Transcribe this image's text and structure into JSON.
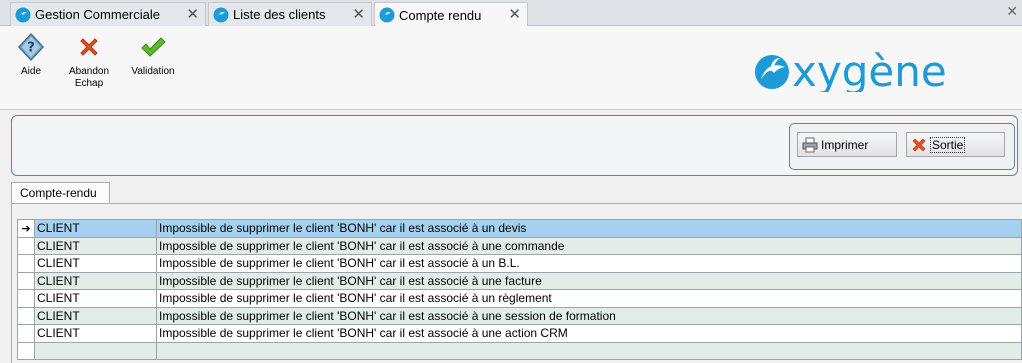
{
  "tabs": [
    {
      "label": "Gestion Commerciale",
      "active": false
    },
    {
      "label": "Liste des clients",
      "active": false
    },
    {
      "label": "Compte rendu",
      "active": true
    }
  ],
  "toolbar": {
    "aide": "Aide",
    "abandon": "Abandon",
    "abandon_shortcut": "Echap",
    "validation": "Validation"
  },
  "logo_text": "oxygène",
  "buttons": {
    "print": "Imprimer",
    "exit": "Sortie"
  },
  "content_tab": "Compte-rendu",
  "rows": [
    {
      "type": "CLIENT",
      "message": "Impossible de supprimer le client 'BONH' car il est associé à un devis",
      "selected": true
    },
    {
      "type": "CLIENT",
      "message": "Impossible de supprimer le client 'BONH' car il est associé à une commande"
    },
    {
      "type": "CLIENT",
      "message": "Impossible de supprimer le client 'BONH' car il est associé à un B.L."
    },
    {
      "type": "CLIENT",
      "message": "Impossible de supprimer le client 'BONH' car il est associé à une facture"
    },
    {
      "type": "CLIENT",
      "message": "Impossible de supprimer le client 'BONH' car il est associé à un règlement"
    },
    {
      "type": "CLIENT",
      "message": "Impossible de supprimer le client 'BONH' car il est associé à une session de formation"
    },
    {
      "type": "CLIENT",
      "message": "Impossible de supprimer le client 'BONH' car il est associé à une action CRM"
    },
    {
      "type": "",
      "message": ""
    }
  ],
  "colors": {
    "selected_row": "#a5d1f0",
    "alt_row": "#e3ede7",
    "logo_blue": "#1e9ad6"
  }
}
